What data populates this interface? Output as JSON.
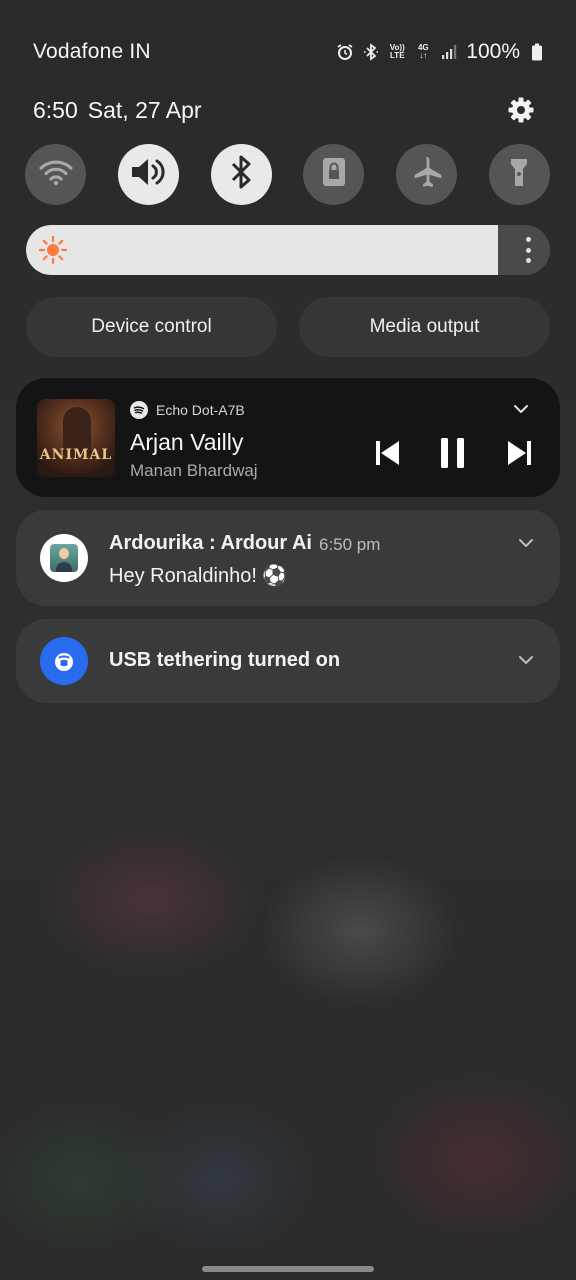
{
  "status_bar": {
    "carrier": "Vodafone IN",
    "icons": [
      "alarm-icon",
      "bluetooth-icon",
      "volte-icon",
      "4g-icon",
      "signal-icon"
    ],
    "volte_top": "Vo))",
    "volte_bottom": "LTE",
    "net_top": "4G",
    "net_bottom": "↓↑",
    "battery_percent": "100%"
  },
  "header": {
    "time": "6:50",
    "date": "Sat, 27 Apr"
  },
  "quick_toggles": [
    {
      "name": "wifi-icon",
      "on": false
    },
    {
      "name": "sound-icon",
      "on": true
    },
    {
      "name": "bluetooth-icon",
      "on": true
    },
    {
      "name": "screen-lock-icon",
      "on": false
    },
    {
      "name": "airplane-icon",
      "on": false
    },
    {
      "name": "flashlight-icon",
      "on": false
    }
  ],
  "brightness": {
    "level_fraction": 0.9
  },
  "pills": {
    "device_control": "Device control",
    "media_output": "Media output"
  },
  "media": {
    "album_art_text": "ANIMAL",
    "source": "Echo Dot-A7B",
    "title": "Arjan Vailly",
    "artist": "Manan Bhardwaj"
  },
  "notifications": [
    {
      "app": "Ardourika : Ardour Ai",
      "time": "6:50 pm",
      "text": "Hey Ronaldinho! ⚽"
    },
    {
      "title": "USB tethering turned on"
    }
  ],
  "colors": {
    "accent_usb": "#2a6cf0",
    "sun_icon": "#ff7a3d",
    "toggle_on": "#e9e9e9",
    "toggle_off": "#555555"
  }
}
